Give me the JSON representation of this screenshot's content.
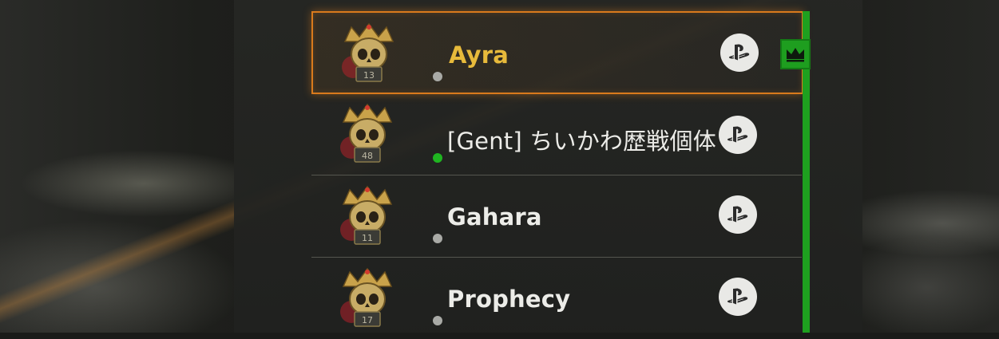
{
  "party": {
    "members": [
      {
        "name": "Ayra",
        "rank": "13",
        "status": "offline",
        "platform_icon": "playstation-icon",
        "selected": true,
        "leader": true
      },
      {
        "name": "[Gent] ちいかわ歴戦個体",
        "rank": "48",
        "status": "online",
        "platform_icon": "playstation-icon",
        "selected": false,
        "leader": false
      },
      {
        "name": "Gahara",
        "rank": "11",
        "status": "offline",
        "platform_icon": "playstation-icon",
        "selected": false,
        "leader": false
      },
      {
        "name": "Prophecy",
        "rank": "17",
        "status": "offline",
        "platform_icon": "playstation-icon",
        "selected": false,
        "leader": false
      }
    ],
    "leader_icon": "crown-icon",
    "colors": {
      "selection_outline": "#d97a1c",
      "leader_name": "#e7ba3b",
      "online": "#1fb521",
      "offline": "#a9aaa6",
      "party_bar": "#1ea01f"
    }
  }
}
